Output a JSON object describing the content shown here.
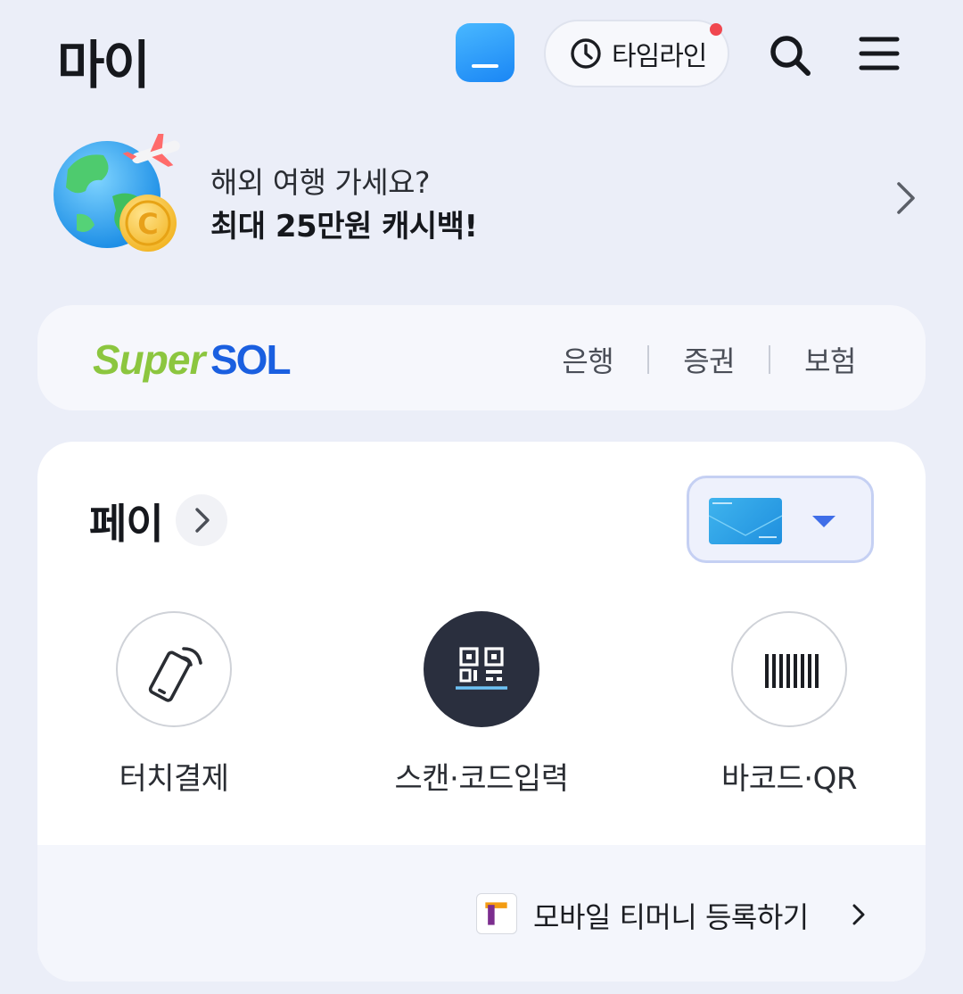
{
  "header": {
    "title": "마이",
    "timeline_label": "타임라인",
    "icons": [
      "app-tile-icon",
      "clock-icon",
      "search-icon",
      "menu-icon"
    ],
    "notification_dot_color": "#f0474f"
  },
  "promo": {
    "line1": "해외 여행 가세요?",
    "line2": "최대 25만원 캐시백!",
    "icons": [
      "globe-airplane-coin-icon",
      "chevron-right-icon"
    ]
  },
  "supersol": {
    "logo_super": "Super",
    "logo_sol": "SOL",
    "links": [
      "은행",
      "증권",
      "보험"
    ]
  },
  "pay": {
    "title": "페이",
    "actions": [
      {
        "label": "터치결제",
        "icon": "phone-nfc-icon"
      },
      {
        "label": "스캔·코드입력",
        "icon": "qr-scan-icon"
      },
      {
        "label": "바코드·QR",
        "icon": "barcode-icon"
      }
    ],
    "tmoney_label": "모바일 티머니 등록하기"
  },
  "colors": {
    "background": "#ebeef8",
    "accent_blue": "#3f6ee8",
    "logo_green": "#8cc63f",
    "logo_blue": "#1a5fe0",
    "scan_circle": "#2a2f3e"
  }
}
